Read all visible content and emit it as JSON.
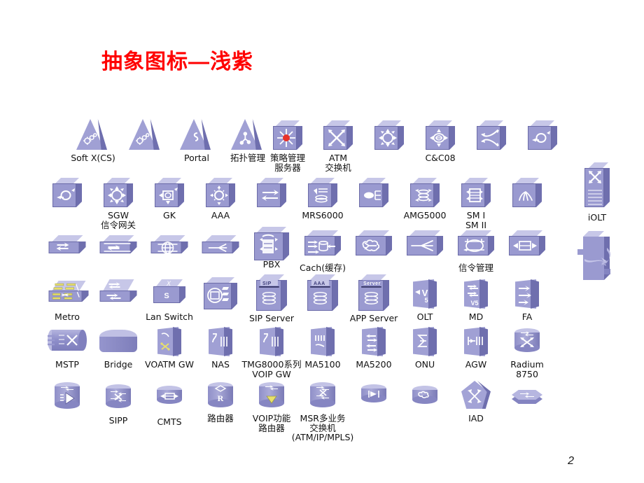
{
  "slide": {
    "title": "抽象图标—浅紫",
    "page_number": "2",
    "title_color": "#FF0000",
    "background_color": "#FFFFFF",
    "icon_face_color": "#9A9AD0",
    "icon_top_color": "#C7C7E8",
    "icon_side_color": "#6F6FAE",
    "accent_red": "#E8322A",
    "accent_yellow": "#E8E06A"
  },
  "rows": [
    {
      "id": "row1",
      "items": [
        {
          "name": "soft-x-cs",
          "label": "Soft X(CS)",
          "shape": "triangle-gear"
        },
        {
          "name": "soft-x-cs-alt",
          "label": "",
          "shape": "triangle-gear"
        },
        {
          "name": "portal",
          "label": "Portal",
          "shape": "triangle-s"
        },
        {
          "name": "topology-mgmt",
          "label": "拓扑管理",
          "shape": "triangle-y"
        },
        {
          "name": "policy-mgmt-server",
          "label": "策略管理\n服务器",
          "shape": "box-star-red"
        },
        {
          "name": "atm-switch",
          "label": "ATM\n交换机",
          "shape": "box-x-arrows"
        },
        {
          "name": "box-circle-arrows",
          "label": "",
          "shape": "box-circle-arrows"
        },
        {
          "name": "cc08",
          "label": "C&C08",
          "shape": "box-hex-arrows"
        },
        {
          "name": "box-cross-arrows",
          "label": "",
          "shape": "box-cross-arrows"
        },
        {
          "name": "box-ring-arrow",
          "label": "",
          "shape": "box-ring-arrow"
        }
      ]
    },
    {
      "id": "row2",
      "items": [
        {
          "name": "box-ring-arrow-2",
          "label": "",
          "shape": "box-ring-arrow"
        },
        {
          "name": "sgw",
          "label": "SGW\n信令网关",
          "shape": "box-circle-arrows"
        },
        {
          "name": "gk",
          "label": "GK",
          "shape": "box-ring-arrow-box"
        },
        {
          "name": "aaa",
          "label": "AAA",
          "shape": "box-sun-arrows"
        },
        {
          "name": "box-swap",
          "label": "",
          "shape": "box-swap"
        },
        {
          "name": "mrs6000",
          "label": "MRS6000",
          "shape": "box-speaker-disk"
        },
        {
          "name": "box-oval-lines",
          "label": "",
          "shape": "box-oval-lines"
        },
        {
          "name": "amg5000",
          "label": "AMG5000",
          "shape": "box-disk-arrows"
        },
        {
          "name": "sm1-sm2",
          "label": "SM I\nSM II",
          "shape": "box-rack-arrows"
        },
        {
          "name": "box-fan",
          "label": "",
          "shape": "box-fan"
        }
      ]
    },
    {
      "id": "row3",
      "items": [
        {
          "name": "flat-x",
          "label": "",
          "shape": "flat-x"
        },
        {
          "name": "flat-x-lines",
          "label": "",
          "shape": "flat-x-lines"
        },
        {
          "name": "flat-globe",
          "label": "",
          "shape": "flat-globe"
        },
        {
          "name": "flat-fork",
          "label": "",
          "shape": "flat-fork"
        },
        {
          "name": "pbx",
          "label": "PBX",
          "shape": "box-pbx"
        },
        {
          "name": "cache",
          "label": "Cach(缓存)",
          "shape": "box-cache"
        },
        {
          "name": "box-cloud",
          "label": "",
          "shape": "box-cloud"
        },
        {
          "name": "box-fork",
          "label": "",
          "shape": "box-fork"
        },
        {
          "name": "signaling-mgmt",
          "label": "信令管理",
          "shape": "box-signal-ring"
        },
        {
          "name": "box-arrows-bar",
          "label": "",
          "shape": "box-arrows-bar"
        }
      ]
    },
    {
      "id": "row4",
      "items": [
        {
          "name": "metro",
          "label": "Metro",
          "shape": "metro"
        },
        {
          "name": "box-xx",
          "label": "",
          "shape": "box-xx"
        },
        {
          "name": "lan-switch",
          "label": "Lan Switch",
          "shape": "box-x-s"
        },
        {
          "name": "box-disc-slots",
          "label": "",
          "shape": "box-disc-slots"
        },
        {
          "name": "sip-server",
          "label": "SIP Server",
          "chip": "SIP",
          "shape": "box-chip-disk"
        },
        {
          "name": "aaa-server",
          "label": "",
          "chip": "AAA",
          "shape": "box-chip-disk"
        },
        {
          "name": "app-server",
          "label": "APP Server",
          "chip": "Server",
          "shape": "box-chip-disk"
        },
        {
          "name": "olt",
          "label": "OLT",
          "shape": "wedge-v5"
        },
        {
          "name": "md",
          "label": "MD",
          "shape": "wedge-xv5"
        },
        {
          "name": "fa",
          "label": "FA",
          "shape": "wedge-arrows"
        }
      ]
    },
    {
      "id": "row5",
      "items": [
        {
          "name": "mstp",
          "label": "MSTP",
          "shape": "hcyl-mstp"
        },
        {
          "name": "bridge",
          "label": "Bridge",
          "shape": "bridge"
        },
        {
          "name": "voatm-gw",
          "label": "VOATM GW",
          "shape": "wedge-voatm"
        },
        {
          "name": "nas",
          "label": "NAS",
          "shape": "wedge-nas"
        },
        {
          "name": "tmg8000",
          "label": "TMG8000系列\nVOIP GW",
          "shape": "wedge-nas"
        },
        {
          "name": "ma5100",
          "label": "MA5100",
          "shape": "wedge-bars"
        },
        {
          "name": "ma5200",
          "label": "MA5200",
          "shape": "wedge-updown"
        },
        {
          "name": "onu",
          "label": "ONU",
          "shape": "wedge-onu"
        },
        {
          "name": "agw",
          "label": "AGW",
          "shape": "wedge-agw"
        },
        {
          "name": "radium8750",
          "label": "Radium\n8750",
          "shape": "cyl-x"
        }
      ]
    },
    {
      "id": "row6",
      "items": [
        {
          "name": "cyl-play",
          "label": "",
          "shape": "cyl-play"
        },
        {
          "name": "sipp",
          "label": "SIPP",
          "shape": "cyl-x-lines"
        },
        {
          "name": "cmts",
          "label": "CMTS",
          "shape": "cyl-arrows-bar"
        },
        {
          "name": "router",
          "label": "路由器",
          "shape": "cyl-router-r"
        },
        {
          "name": "voip-router",
          "label": "VOIP功能\n路由器",
          "shape": "cyl-router-v"
        },
        {
          "name": "msr-switch",
          "label": "MSR多业务\n交换机\n(ATM/IP/MPLS)",
          "shape": "cyl-router-xx"
        },
        {
          "name": "cyl-play-flag",
          "label": "",
          "shape": "cyl-play-flag"
        },
        {
          "name": "cyl-cloudlet",
          "label": "",
          "shape": "cyl-cloudlet"
        },
        {
          "name": "iad",
          "label": "IAD",
          "shape": "pentagon-arrows"
        },
        {
          "name": "puck-x",
          "label": "",
          "shape": "puck-x"
        }
      ]
    }
  ],
  "side_items": [
    {
      "name": "iolt",
      "label": "iOLT",
      "shape": "rack-x"
    },
    {
      "name": "cabinet",
      "label": "",
      "shape": "cabinet-swirl"
    }
  ]
}
